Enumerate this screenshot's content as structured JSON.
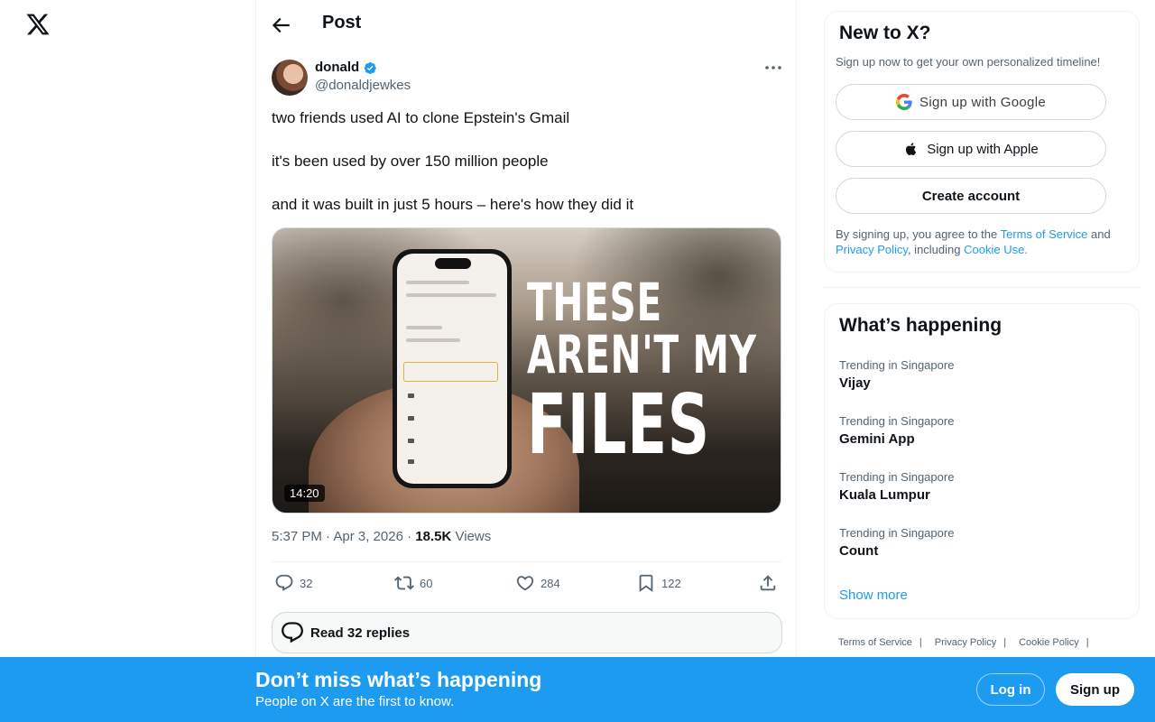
{
  "nav": {
    "logo_icon": "x-logo-icon"
  },
  "header": {
    "title": "Post"
  },
  "post": {
    "author_name": "donald",
    "author_handle": "@donaldjewkes",
    "text_lines": [
      "two friends used AI to clone Epstein's Gmail",
      "it's been used by over 150 million people",
      "and it was built in just 5 hours – here's how they did it"
    ],
    "media": {
      "overlay_lines": [
        "THESE",
        "AREN'T MY",
        "FILES"
      ],
      "duration": "14:20"
    },
    "time": "5:37 PM · Apr 3, 2026 · ",
    "views_count": "18.5K",
    "views_label": " Views",
    "actions": {
      "replies": "32",
      "reposts": "60",
      "likes": "284",
      "bookmarks": "122"
    },
    "read_replies_label": "Read 32 replies"
  },
  "signup": {
    "title": "New to X?",
    "subtitle": "Sign up now to get your own personalized timeline!",
    "google_label": "Sign up with Google",
    "apple_label": "Sign up with Apple",
    "create_label": "Create account",
    "legal_prefix": "By signing up, you agree to the ",
    "terms": "Terms of Service",
    "and": " and ",
    "privacy": "Privacy Policy",
    "including": ", including ",
    "cookie": "Cookie Use."
  },
  "trends": {
    "title": "What’s happening",
    "items": [
      {
        "context": "Trending in Singapore",
        "name": "Vijay"
      },
      {
        "context": "Trending in Singapore",
        "name": "Gemini App"
      },
      {
        "context": "Trending in Singapore",
        "name": "Kuala Lumpur"
      },
      {
        "context": "Trending in Singapore",
        "name": "Count"
      }
    ],
    "show_more": "Show more"
  },
  "footer": {
    "links": [
      "Terms of Service",
      "Privacy Policy",
      "Cookie Policy"
    ]
  },
  "banner": {
    "title": "Don’t miss what’s happening",
    "subtitle": "People on X are the first to know.",
    "login": "Log in",
    "signup": "Sign up"
  },
  "colors": {
    "accent": "#1d9bf0",
    "text": "#0f1419",
    "muted": "#536471",
    "border": "#eff3f4"
  }
}
